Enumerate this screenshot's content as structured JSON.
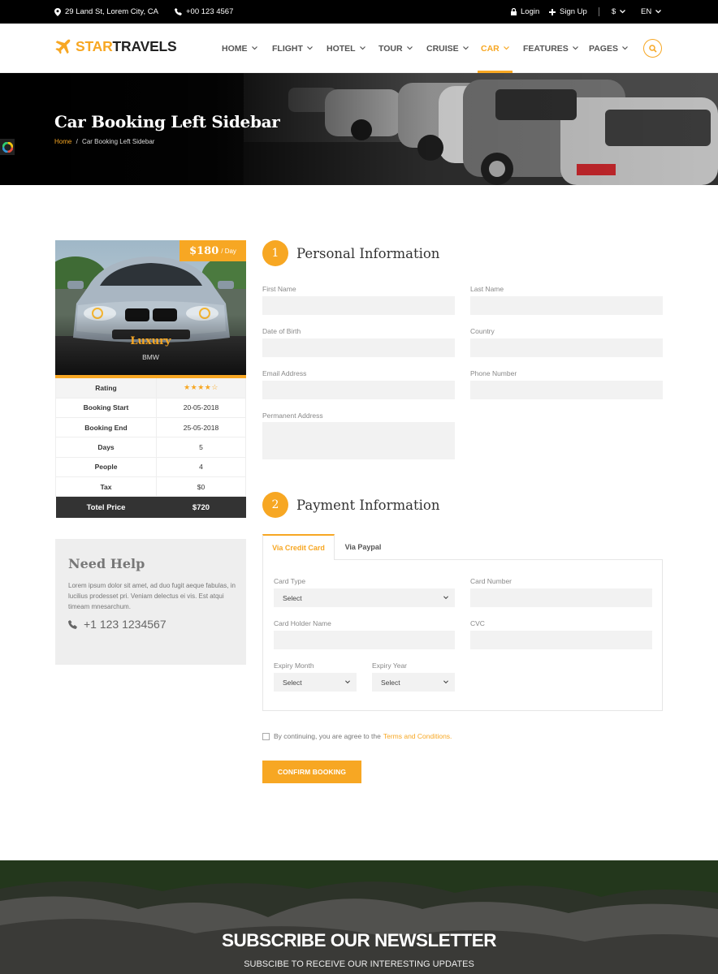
{
  "topbar": {
    "address": "29 Land St, Lorem City, CA",
    "phone": "+00 123 4567",
    "login": "Login",
    "signup": "Sign Up",
    "currency": "$",
    "language": "EN"
  },
  "brand": {
    "part1": "STAR",
    "part2": "TRAVELS"
  },
  "nav": [
    "HOME",
    "FLIGHT",
    "HOTEL",
    "TOUR",
    "CRUISE",
    "CAR",
    "FEATURES",
    "PAGES"
  ],
  "banner": {
    "title": "Car Booking Left Sidebar",
    "breadcrumb_home": "Home",
    "breadcrumb_sep": "/",
    "breadcrumb_current": "Car Booking Left Sidebar"
  },
  "car": {
    "price": "$180",
    "per": "/ Day",
    "class": "Luxury",
    "brand": "BMW",
    "rating_label": "Rating",
    "rating_stars": "★★★★☆",
    "rows": [
      {
        "label": "Booking Start",
        "value": "20-05-2018"
      },
      {
        "label": "Booking End",
        "value": "25-05-2018"
      },
      {
        "label": "Days",
        "value": "5"
      },
      {
        "label": "People",
        "value": "4"
      },
      {
        "label": "Tax",
        "value": "$0"
      }
    ],
    "total_label": "Totel Price",
    "total_value": "$720"
  },
  "help": {
    "title": "Need Help",
    "text": "Lorem ipsum dolor sit amet, ad duo fugit aeque fabulas, in lucilius prodesset pri. Veniam delectus ei vis. Est atqui timeam mnesarchum.",
    "phone": "+1 123 1234567"
  },
  "personal": {
    "num": "1",
    "title": "Personal Information",
    "first_name": "First Name",
    "last_name": "Last Name",
    "dob": "Date of Birth",
    "country": "Country",
    "email": "Email Address",
    "phone": "Phone Number",
    "address": "Permanent Address"
  },
  "payment": {
    "num": "2",
    "title": "Payment Information",
    "tab_card": "Via Credit Card",
    "tab_paypal": "Via Paypal",
    "card_type": "Card Type",
    "card_type_value": "Select",
    "card_number": "Card Number",
    "holder": "Card Holder Name",
    "cvc": "CVC",
    "exp_month": "Expiry Month",
    "exp_month_value": "Select",
    "exp_year": "Expiry Year",
    "exp_year_value": "Select"
  },
  "agree": {
    "text": "By continuing, you are agree to the",
    "link": "Terms and Conditions."
  },
  "confirm": "CONFIRM BOOKING",
  "newsletter": {
    "title": "SUBSCRIBE OUR NEWSLETTER",
    "subtitle": "SUBSCIBE TO RECEIVE OUR INTERESTING UPDATES"
  },
  "colors": {
    "accent": "#f7a723",
    "dark": "#000000"
  },
  "icons": [
    "map-marker-icon",
    "phone-icon",
    "lock-icon",
    "plus-icon",
    "chevron-down-icon",
    "plane-icon",
    "search-icon"
  ]
}
